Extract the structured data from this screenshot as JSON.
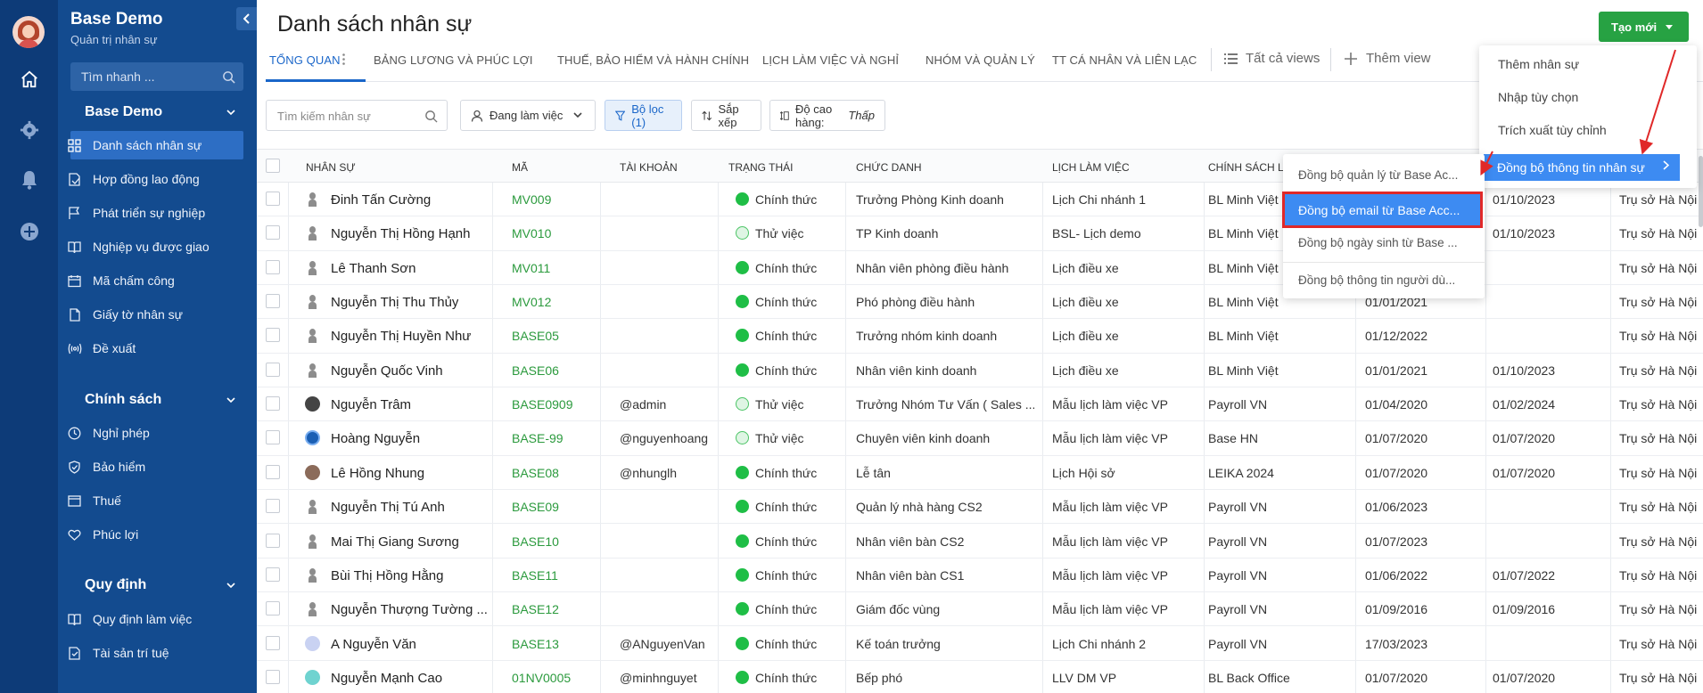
{
  "sidebar": {
    "org_name": "Base Demo",
    "org_sub": "Quản trị nhân sự",
    "search_placeholder": "Tìm nhanh ...",
    "section1": "Base Demo",
    "items1": [
      "Danh sách nhân sự",
      "Hợp đồng lao động",
      "Phát triển sự nghiệp",
      "Nghiệp vụ được giao",
      "Mã chấm công",
      "Giấy tờ nhân sự",
      "Đề xuất"
    ],
    "section2": "Chính sách",
    "items2": [
      "Nghỉ phép",
      "Bảo hiểm",
      "Thuế",
      "Phúc lợi"
    ],
    "section3": "Quy định",
    "items3": [
      "Quy định làm việc",
      "Tài sản trí tuệ"
    ]
  },
  "header": {
    "title": "Danh sách nhân sự",
    "create_label": "Tạo mới"
  },
  "tabs": [
    "Tổng quan",
    "Bảng lương và phúc lợi",
    "Thuế, bảo hiểm và hành chính",
    "Lịch làm việc và nghỉ",
    "Nhóm và quản lý",
    "TT cá nhân và liên lạc"
  ],
  "views": {
    "all": "Tất cả views",
    "add": "Thêm view"
  },
  "toolbar": {
    "search_placeholder": "Tìm kiếm nhân sự",
    "status_filter": "Đang làm việc",
    "filter": "Bộ lọc (1)",
    "sort": "Sắp xếp",
    "row_height_label": "Độ cao hàng:",
    "row_height_value": "Thấp"
  },
  "columns": [
    "Nhân sự",
    "Mã",
    "Tài khoản",
    "Trạng thái",
    "Chức danh",
    "Lịch làm việc",
    "Chính sách l"
  ],
  "rows": [
    {
      "name": "Đinh Tấn Cường",
      "code": "MV009",
      "account": "",
      "status": "Chính thức",
      "title": "Trưởng Phòng Kinh doanh",
      "schedule": "Lịch Chi nhánh 1",
      "policy": "BL Minh Việt",
      "d1": "",
      "d2": "01/10/2023",
      "office": "Trụ sở Hà Nội",
      "avatar": "gen"
    },
    {
      "name": "Nguyễn Thị Hồng Hạnh",
      "code": "MV010",
      "account": "",
      "status": "Thử việc",
      "title": "TP Kinh doanh",
      "schedule": "BSL- Lịch demo",
      "policy": "BL Minh Việt",
      "d1": "",
      "d2": "01/10/2023",
      "office": "Trụ sở Hà Nội",
      "avatar": "gen"
    },
    {
      "name": "Lê Thanh Sơn",
      "code": "MV011",
      "account": "",
      "status": "Chính thức",
      "title": "Nhân viên phòng điều hành",
      "schedule": "Lịch điều xe",
      "policy": "BL Minh Việt",
      "d1": "",
      "d2": "",
      "office": "Trụ sở Hà Nội",
      "avatar": "gen"
    },
    {
      "name": "Nguyễn Thị Thu Thủy",
      "code": "MV012",
      "account": "",
      "status": "Chính thức",
      "title": "Phó phòng điều hành",
      "schedule": "Lịch điều xe",
      "policy": "BL Minh Việt",
      "d1": "01/01/2021",
      "d2": "",
      "office": "Trụ sở Hà Nội",
      "avatar": "gen"
    },
    {
      "name": "Nguyễn Thị Huyền Như",
      "code": "BASE05",
      "account": "",
      "status": "Chính thức",
      "title": "Trưởng nhóm kinh doanh",
      "schedule": "Lịch điều xe",
      "policy": "BL Minh Việt",
      "d1": "01/12/2022",
      "d2": "",
      "office": "Trụ sở Hà Nội",
      "avatar": "gen"
    },
    {
      "name": "Nguyễn Quốc Vinh",
      "code": "BASE06",
      "account": "",
      "status": "Chính thức",
      "title": "Nhân viên kinh doanh",
      "schedule": "Lịch điều xe",
      "policy": "BL Minh Việt",
      "d1": "01/01/2021",
      "d2": "01/10/2023",
      "office": "Trụ sở Hà Nội",
      "avatar": "gen"
    },
    {
      "name": "Nguyễn Trâm",
      "code": "BASE0909",
      "account": "@admin",
      "status": "Thử việc",
      "title": "Trưởng Nhóm Tư Vấn ( Sales ...",
      "schedule": "Mẫu lịch làm việc VP",
      "policy": "Payroll VN",
      "d1": "01/04/2020",
      "d2": "01/02/2024",
      "office": "Trụ sở Hà Nội",
      "avatar": "dark"
    },
    {
      "name": "Hoàng Nguyễn",
      "code": "BASE-99",
      "account": "@nguyenhoang",
      "status": "Thử việc",
      "title": "Chuyên viên kinh doanh",
      "schedule": "Mẫu lịch làm việc VP",
      "policy": "Base HN",
      "d1": "01/07/2020",
      "d2": "01/07/2020",
      "office": "Trụ sở Hà Nội",
      "avatar": "blue"
    },
    {
      "name": "Lê Hồng Nhung",
      "code": "BASE08",
      "account": "@nhunglh",
      "status": "Chính thức",
      "title": "Lễ tân",
      "schedule": "Lịch Hội sở",
      "policy": "LEIKA 2024",
      "d1": "01/07/2020",
      "d2": "01/07/2020",
      "office": "Trụ sở Hà Nội",
      "avatar": "photo"
    },
    {
      "name": "Nguyễn Thị Tú Anh",
      "code": "BASE09",
      "account": "",
      "status": "Chính thức",
      "title": "Quản lý nhà hàng CS2",
      "schedule": "Mẫu lịch làm việc VP",
      "policy": "Payroll VN",
      "d1": "01/06/2023",
      "d2": "",
      "office": "Trụ sở Hà Nội",
      "avatar": "gen"
    },
    {
      "name": "Mai Thị Giang Sương",
      "code": "BASE10",
      "account": "",
      "status": "Chính thức",
      "title": "Nhân viên bàn CS2",
      "schedule": "Mẫu lịch làm việc VP",
      "policy": "Payroll VN",
      "d1": "01/07/2023",
      "d2": "",
      "office": "Trụ sở Hà Nội",
      "avatar": "gen"
    },
    {
      "name": "Bùi Thị Hồng Hằng",
      "code": "BASE11",
      "account": "",
      "status": "Chính thức",
      "title": "Nhân viên bàn CS1",
      "schedule": "Mẫu lịch làm việc VP",
      "policy": "Payroll VN",
      "d1": "01/06/2022",
      "d2": "01/07/2022",
      "office": "Trụ sở Hà Nội",
      "avatar": "gen"
    },
    {
      "name": "Nguyễn Thượng Tường ...",
      "code": "BASE12",
      "account": "",
      "status": "Chính thức",
      "title": "Giám đốc vùng",
      "schedule": "Mẫu lịch làm việc VP",
      "policy": "Payroll VN",
      "d1": "01/09/2016",
      "d2": "01/09/2016",
      "office": "Trụ sở Hà Nội",
      "avatar": "gen"
    },
    {
      "name": "A Nguyễn Văn",
      "code": "BASE13",
      "account": "@ANguyenVan",
      "status": "Chính thức",
      "title": "Kế toán trưởng",
      "schedule": "Lịch Chi nhánh 2",
      "policy": "Payroll VN",
      "d1": "17/03/2023",
      "d2": "",
      "office": "Trụ sở Hà Nội",
      "avatar": "lilac"
    },
    {
      "name": "Nguyễn Mạnh Cao",
      "code": "01NV0005",
      "account": "@minhnguyet",
      "status": "Chính thức",
      "title": "Bếp phó",
      "schedule": "LLV DM VP",
      "policy": "BL Back Office",
      "d1": "01/07/2020",
      "d2": "01/07/2020",
      "office": "Trụ sở Hà Nội",
      "avatar": "teal"
    }
  ],
  "create_menu": {
    "items": [
      "Thêm nhân sự",
      "Nhập tùy chọn",
      "Trích xuất tùy chỉnh"
    ],
    "highlighted": "Đồng bộ thông tin nhân sự"
  },
  "sync_submenu": {
    "item1": "Đồng bộ quản lý từ Base Ac...",
    "highlighted": "Đồng bộ email từ Base Acc...",
    "item3": "Đồng bộ ngày sinh từ Base ...",
    "item4": "Đồng bộ thông tin người dù..."
  },
  "colors": {
    "sidebar_bg": "#134b8f",
    "rail_bg": "#0d3b78",
    "active_item": "#2d6ec4",
    "accent": "#1a66c9",
    "create_green": "#27a243",
    "status_green": "#1fbe46",
    "menu_highlight": "#3d8bf2",
    "annotation_red": "#e02828"
  }
}
